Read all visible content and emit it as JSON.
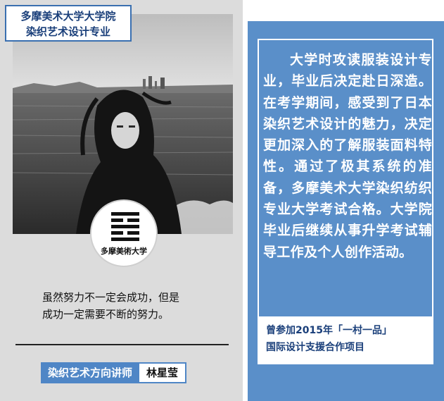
{
  "school": {
    "line1": "多摩美术大学大学院",
    "line2": "染织艺术设计专业"
  },
  "logo": {
    "icon": "tama-university-logo-icon",
    "text": "多摩美術大学"
  },
  "quote": {
    "line1": "虽然努力不一定会成功，但是",
    "line2": "成功一定需要不断的努力。"
  },
  "teacher": {
    "role": "染织艺术方向讲师",
    "name": "林星莹"
  },
  "bio": "大学时攻读服装设计专业，毕业后决定赴日深造。在考学期间，感受到了日本染织艺术设计的魅力，决定更加深入的了解服装面料特性。通过了极其系统的准备，多摩美术大学染织纺织专业大学考试合格。大学院毕业后继续从事升学考试辅导工作及个人创作活动。",
  "project": {
    "line1": "曾参加2015年「一村一品」",
    "line2": "国际设计支援合作项目"
  },
  "colors": {
    "accent_blue": "#5a8fc9",
    "dark_blue_text": "#1a3f7a",
    "left_bg": "#dcdcdc"
  }
}
